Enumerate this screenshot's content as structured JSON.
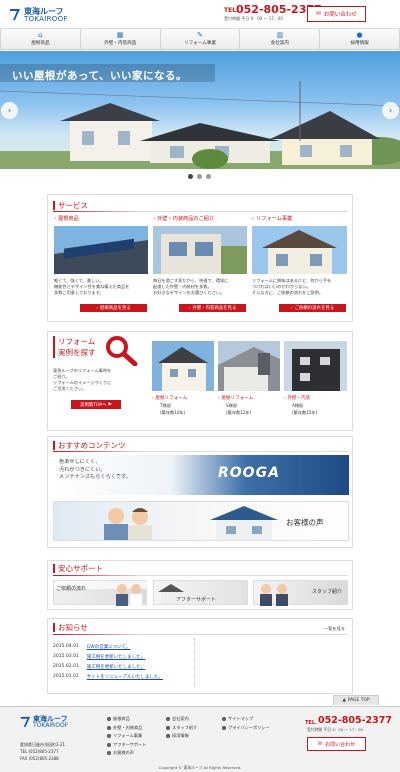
{
  "header": {
    "logo_jp": "東海ルーフ",
    "logo_en": "TOKAIROOF",
    "phone": "052-805-2377",
    "phone_prefix": "TEL.",
    "hours": "受付時間 平日 9：00 ～ 17：00",
    "contact_label": "お問い合わせ"
  },
  "nav": {
    "items": [
      {
        "label": "屋根商品",
        "icon": "roof-icon"
      },
      {
        "label": "外壁・内装商品",
        "icon": "wall-icon"
      },
      {
        "label": "リフォーム事業",
        "icon": "wrench-icon"
      },
      {
        "label": "会社案内",
        "icon": "building-icon"
      },
      {
        "label": "採用情報",
        "icon": "person-icon"
      }
    ]
  },
  "hero": {
    "catch": "いい屋根があって、いい家になる。",
    "slide_count": 3,
    "active_slide": 1
  },
  "services": {
    "title": "サービス",
    "items": [
      {
        "title": "屋根商品",
        "text": "軽くて、強くて、美しい。\n機能性とデザイン性を兼ね備えた商品を\n多数ご用意しております。",
        "button": "屋根商品を見る"
      },
      {
        "title": "外壁・内装商品のご紹介",
        "text": "毎日を過ごす家だから、快適で、環境に\n配慮した外壁・内装材を多数。\nお好きなデザインをお選びください。",
        "button": "外壁・内装商品を見る"
      },
      {
        "title": "リフォーム事業",
        "text": "リフォームに興味はあるけど、何から手を\nつければいいのかわからない。\nそんな方に、ご依頼の流れをご説明。",
        "button": "ご依頼の流れを見る"
      }
    ]
  },
  "reform": {
    "title_line1": "リフォーム",
    "title_line2": "実例を探す",
    "text": "東急ルーフのリフォーム事例を\nご紹介。\nリフォームのイメージづくりに\nご活用ください。",
    "button": "実例集TOPへ",
    "examples": [
      {
        "category": "屋根リフォーム",
        "city": "T様邸",
        "age": "(築年数10年)"
      },
      {
        "category": "屋根リフォーム",
        "city": "S様邸",
        "age": "(築年数12年)"
      },
      {
        "category": "外壁・内装",
        "city": "A様邸",
        "age": "(築年数15年)"
      }
    ]
  },
  "recommend": {
    "title": "おすすめコンテンツ",
    "banner1_text": "色あせしにくく、\n汚れがつきにくい。\nメンテナンスもらくらくです。",
    "banner1_brand": "ROOGA",
    "banner2_text": "お客様の声"
  },
  "support": {
    "title": "安心サポート",
    "items": [
      "ご依頼の流れ",
      "アフターサポート",
      "スタッフ紹介"
    ]
  },
  "news": {
    "title": "お知らせ",
    "list_link": "一覧を見る",
    "items": [
      {
        "date": "2015.04.01",
        "text": "GWの営業について。"
      },
      {
        "date": "2015.03.01",
        "text": "施工例を更新いたしました。"
      },
      {
        "date": "2015.02.01",
        "text": "施工例を更新いたしました。"
      },
      {
        "date": "2015.01.01",
        "text": "サイトをリニューアルいたしました。"
      }
    ]
  },
  "pagetop": "PAGE TOP",
  "footer": {
    "logo_jp": "東海ルーフ",
    "logo_en": "TOKAIROOF",
    "address": "愛知県日進市浅田町2-21",
    "tel": "TEL (052)805-2377",
    "fax": "FAX (052)805-2388",
    "col1": [
      "屋根商品",
      "外壁・内装商品",
      "リフォーム事業",
      "アフターサポート",
      "お客様の声"
    ],
    "col2": [
      "会社案内",
      "スタッフ紹介",
      "採用情報"
    ],
    "col3": [
      "サイトマップ",
      "プライバシーポリシー"
    ],
    "phone": "052-805-2377",
    "phone_prefix": "TEL.",
    "hours": "受付時間 平日 9：00 ～ 17：00",
    "contact_label": "お問い合わせ",
    "copyright": "Copyright © 東海ルーフ All Rights Reserved."
  },
  "colors": {
    "accent_red": "#c8161d",
    "brand_blue": "#1a5aa6"
  }
}
